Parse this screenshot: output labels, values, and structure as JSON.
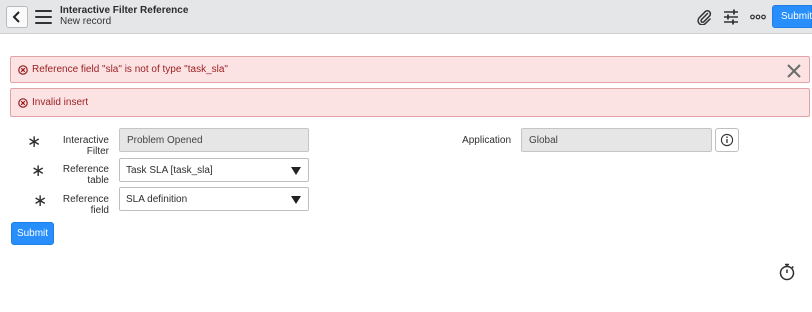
{
  "header": {
    "title": "Interactive Filter Reference",
    "subtitle": "New record",
    "submit_label": "Submit"
  },
  "alerts": [
    {
      "text": "Reference field \"sla\" is not of type \"task_sla\""
    },
    {
      "text": "Invalid insert"
    }
  ],
  "form": {
    "interactive_filter": {
      "label": "Interactive Filter",
      "value": "Problem Opened"
    },
    "reference_table": {
      "label": "Reference table",
      "value": "Task SLA [task_sla]"
    },
    "reference_field": {
      "label": "Reference field",
      "value": "SLA definition"
    },
    "application": {
      "label": "Application",
      "value": "Global"
    },
    "submit_label": "Submit"
  },
  "icons": {
    "back": "chevron-left-icon",
    "menu": "hamburger-menu-icon",
    "attachment": "paperclip-icon",
    "personalize": "sliders-icon",
    "more": "more-options-icon",
    "close": "close-icon",
    "info": "info-icon",
    "error": "error-circle-icon",
    "timer": "stopwatch-icon",
    "mandatory": "asterisk-icon"
  },
  "colors": {
    "accent": "#278efc",
    "error_text": "#9b1c1f",
    "error_bg": "#fbe3e4",
    "header_bg": "#e4e6e7"
  }
}
